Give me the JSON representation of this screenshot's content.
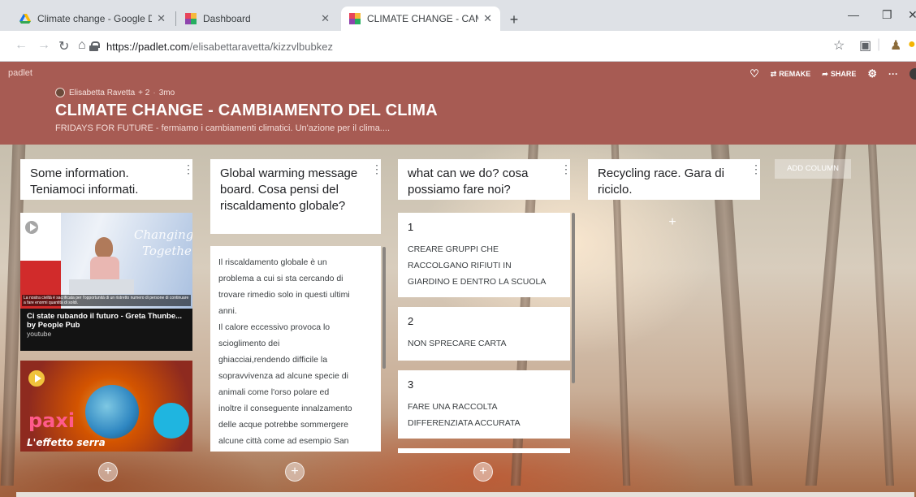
{
  "browser": {
    "tabs": [
      {
        "title": "Climate change - Google Drive",
        "icon": "google-drive-icon"
      },
      {
        "title": "Dashboard",
        "icon": "padlet-icon"
      },
      {
        "title": "CLIMATE CHANGE - CAMBIAMENT",
        "icon": "padlet-icon"
      }
    ],
    "active_tab": 2,
    "url_host": "https://padlet.com",
    "url_path": "/elisabettaravetta/kizzvlbubkez"
  },
  "header": {
    "brand": "padlet",
    "author": "Elisabetta Ravetta",
    "collaborators": "+ 2",
    "age": "3mo",
    "title": "CLIMATE CHANGE - CAMBIAMENTO DEL CLIMA",
    "subtitle": "FRIDAYS FOR FUTURE - fermiamo i cambiamenti climatici. Un'azione per il clima....",
    "remake_label": "REMAKE",
    "share_label": "SHARE",
    "accent_color": "#a75b53"
  },
  "columns": [
    {
      "title": "Some information. Teniamoci informati.",
      "videos": [
        {
          "thumb_text_1": "Changing",
          "thumb_text_2": "Together",
          "thumb_caption": "La nostra civiltà è sacrificata per l'opportunità di un ristretto numero di persone di continuare a fare enormi quantità di soldi.",
          "title": "Ci state rubando il futuro - Greta Thunbe...",
          "author": "by People Pub",
          "source": "youtube"
        },
        {
          "thumb_text_1": "paxi",
          "thumb_text_2": "L'effetto serra"
        }
      ]
    },
    {
      "title": "Global warming message board. Cosa pensi del riscaldamento globale?",
      "post_text_lines": [
        "Il riscaldamento globale è un",
        "problema a cui si sta cercando di",
        "trovare rimedio solo in questi ultimi",
        "anni.",
        "Il calore eccessivo provoca lo",
        "scioglimento dei",
        "ghiacciai,rendendo difficile la",
        "sopravvivenza ad alcune specie di",
        "animali come l'orso polare ed",
        "inoltre il conseguente innalzamento",
        "delle acque potrebbe sommergere",
        "alcune città come ad esempio San"
      ]
    },
    {
      "title": "what can we do? cosa possiamo fare noi?",
      "posts": [
        {
          "number": "1",
          "lines": [
            "CREARE GRUPPI CHE",
            "RACCOLGANO RIFIUTI IN",
            "GIARDINO E DENTRO LA SCUOLA"
          ]
        },
        {
          "number": "2",
          "lines": [
            "NON SPRECARE CARTA"
          ]
        },
        {
          "number": "3",
          "lines": [
            "FARE UNA RACCOLTA",
            "DIFFERENZIATA ACCURATA"
          ]
        }
      ]
    },
    {
      "title": "Recycling race. Gara di riciclo."
    }
  ],
  "add_column_label": "ADD COLUMN",
  "add_post_symbol": "+"
}
